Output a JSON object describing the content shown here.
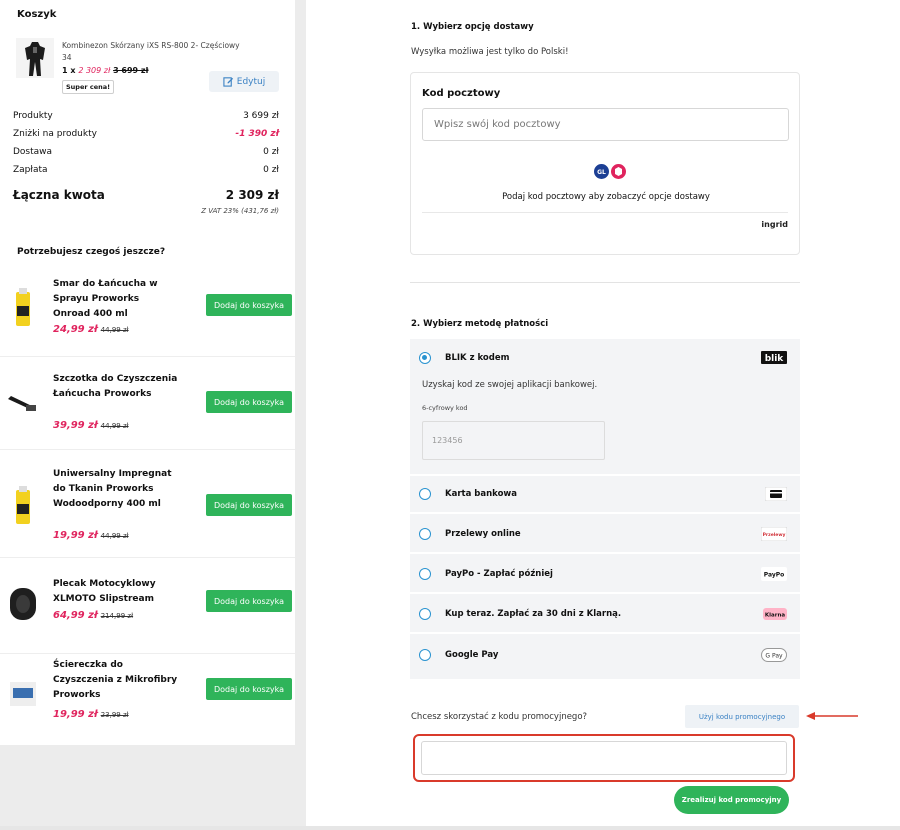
{
  "cart": {
    "title": "Koszyk",
    "item": {
      "name": "Kombinezon Skórzany iXS RS-800 2- Częściowy",
      "variant": "34",
      "qty": "1 x",
      "price": "2 309 zł",
      "old_price": "3 699 zł",
      "badge": "Super cena!"
    },
    "edit_label": "Edytuj",
    "summary": [
      {
        "label": "Produkty",
        "value": "3 699 zł"
      },
      {
        "label": "Zniżki na produkty",
        "value": "-1 390 zł"
      },
      {
        "label": "Dostawa",
        "value": "0 zł"
      },
      {
        "label": "Zapłata",
        "value": "0 zł"
      }
    ],
    "total_label": "Łączna kwota",
    "total_value": "2 309 zł",
    "vat_note": "Z VAT 23% (431,76 zł)"
  },
  "upsell": {
    "title": "Potrzebujesz czegoś jeszcze?",
    "add_label": "Dodaj do koszyka",
    "items": [
      {
        "name": "Smar do Łańcucha w Sprayu Proworks Onroad 400 ml",
        "price": "24,99 zł",
        "old": "44,99 zł"
      },
      {
        "name": "Szczotka do Czyszczenia Łańcucha Proworks",
        "price": "39,99 zł",
        "old": "44,99 zł"
      },
      {
        "name": "Uniwersalny Impregnat do Tkanin Proworks Wodoodporny 400 ml",
        "price": "19,99 zł",
        "old": "44,99 zł"
      },
      {
        "name": "Plecak Motocyklowy XLMOTO Slipstream",
        "price": "64,99 zł",
        "old": "214,99 zł"
      },
      {
        "name": "Ściereczka do Czyszczenia z Mikrofibry Proworks",
        "price": "19,99 zł",
        "old": "23,99 zł"
      }
    ]
  },
  "shipping": {
    "title": "1. Wybierz opcję dostawy",
    "note": "Wysyłka możliwa jest tylko do Polski!",
    "postcode_label": "Kod pocztowy",
    "postcode_placeholder": "Wpisz swój kod pocztowy",
    "info": "Podaj kod pocztowy aby zobaczyć opcje dostawy",
    "provider": "ingrid"
  },
  "payment": {
    "title": "2. Wybierz metodę płatności",
    "blik_desc": "Uzyskaj kod ze swojej aplikacji bankowej.",
    "code_label": "6-cyfrowy kod",
    "code_placeholder": "123456",
    "methods": [
      {
        "label": "BLIK z kodem",
        "logo": "blik",
        "selected": true
      },
      {
        "label": "Karta bankowa",
        "logo": "card-icon",
        "selected": false
      },
      {
        "label": "Przelewy online",
        "logo": "Przelewy24",
        "selected": false
      },
      {
        "label": "PayPo - Zapłać później",
        "logo": "PayPo",
        "selected": false
      },
      {
        "label": "Kup teraz. Zapłać za 30 dni z Klarną.",
        "logo": "Klarna",
        "selected": false
      },
      {
        "label": "Google Pay",
        "logo": "G Pay",
        "selected": false
      }
    ]
  },
  "promo": {
    "question": "Chcesz skorzystać z kodu promocyjnego?",
    "use_label": "Użyj kodu promocyjnego",
    "submit_label": "Zrealizuj kod promocyjny"
  },
  "colors": {
    "accent_green": "#2fb45a",
    "price_red": "#e0245e",
    "link_blue": "#3b82c4",
    "highlight_red": "#d93a2b"
  }
}
